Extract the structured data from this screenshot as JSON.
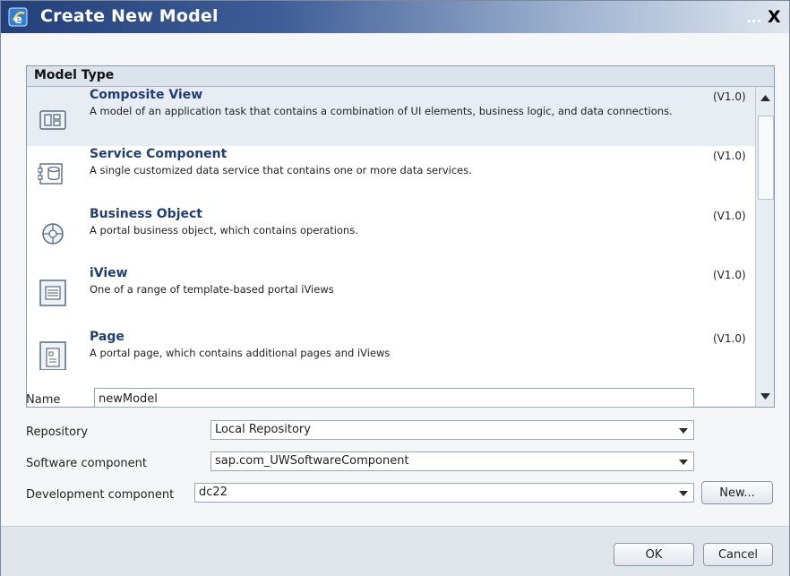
{
  "window": {
    "title": "Create New Model",
    "title_extra": "...",
    "close_label": "X"
  },
  "model_type": {
    "header": "Model Type",
    "items": [
      {
        "name": "Composite View",
        "description": "A model of an application task that contains a combination of UI elements, business logic, and data connections.",
        "version": "(V1.0)",
        "icon": "composite-view-icon",
        "selected": true
      },
      {
        "name": "Service Component",
        "description": "A single customized data service that contains one or more data services.",
        "version": "(V1.0)",
        "icon": "service-component-icon",
        "selected": false
      },
      {
        "name": "Business Object",
        "description": "A portal business object, which contains operations.",
        "version": "(V1.0)",
        "icon": "business-object-icon",
        "selected": false
      },
      {
        "name": "iView",
        "description": "One of a range of template-based portal iViews",
        "version": "(V1.0)",
        "icon": "iview-icon",
        "selected": false
      },
      {
        "name": "Page",
        "description": "A portal page, which contains additional pages and iViews",
        "version": "(V1.0)",
        "icon": "page-icon",
        "selected": false
      }
    ]
  },
  "form": {
    "name_label": "Name",
    "name_value": "newModel",
    "repository_label": "Repository",
    "repository_value": "Local Repository",
    "software_component_label": "Software component",
    "software_component_value": "sap.com_UWSoftwareComponent",
    "development_component_label": "Development component",
    "development_component_value": "dc22",
    "new_button": "New..."
  },
  "buttons": {
    "ok": "OK",
    "cancel": "Cancel"
  },
  "colors": {
    "title_gradient_start": "#23407a",
    "selected_row": "#e7edf3",
    "item_title": "#1f3f74"
  }
}
